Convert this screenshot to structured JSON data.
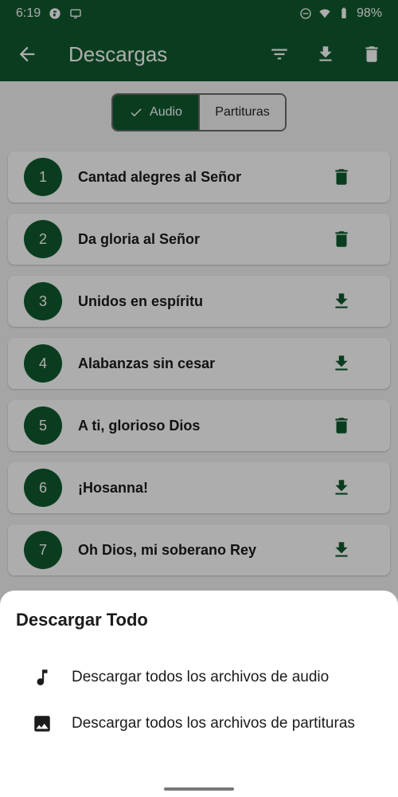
{
  "status_bar": {
    "time": "6:19",
    "battery": "98%"
  },
  "app_bar": {
    "title": "Descargas",
    "icons": [
      "arrow-back-icon",
      "filter-icon",
      "download-icon",
      "delete-icon"
    ]
  },
  "segments": {
    "audio": "Audio",
    "scores": "Partituras"
  },
  "items": [
    {
      "number": "1",
      "label": "Cantad alegres al Señor",
      "action": "delete"
    },
    {
      "number": "2",
      "label": "Da gloria al Señor",
      "action": "delete"
    },
    {
      "number": "3",
      "label": "Unidos en espíritu",
      "action": "download"
    },
    {
      "number": "4",
      "label": "Alabanzas sin cesar",
      "action": "download"
    },
    {
      "number": "5",
      "label": "A ti, glorioso Dios",
      "action": "delete"
    },
    {
      "number": "6",
      "label": "¡Hosanna!",
      "action": "download"
    },
    {
      "number": "7",
      "label": "Oh Dios, mi soberano Rey",
      "action": "download"
    }
  ],
  "sheet": {
    "title": "Descargar Todo",
    "options": [
      {
        "label": "Descargar todos los archivos de audio",
        "icon": "music-note-icon"
      },
      {
        "label": "Descargar todos los archivos de partituras",
        "icon": "image-icon"
      }
    ]
  },
  "colors": {
    "primary": "#0f5a2e",
    "background": "#f3f3f3"
  }
}
